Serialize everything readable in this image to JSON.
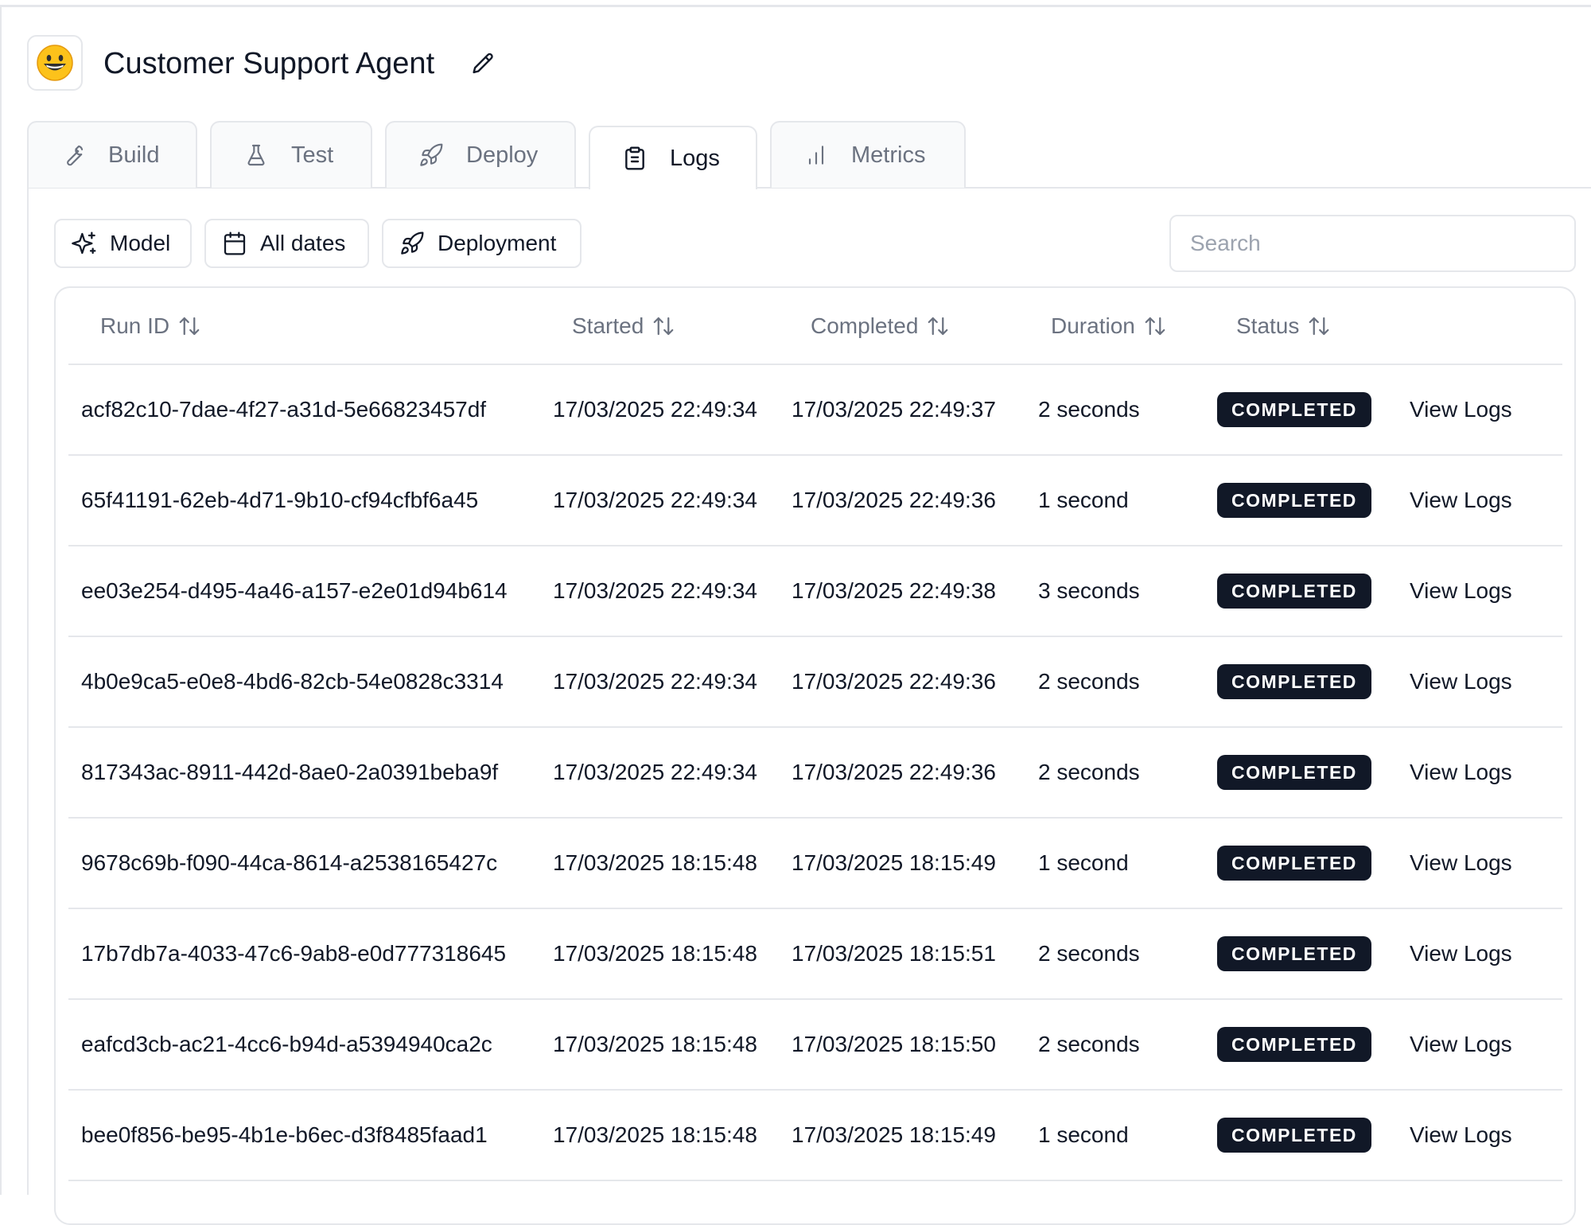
{
  "header": {
    "title": "Customer Support Agent",
    "avatar_emoji": "😀"
  },
  "tabs": [
    {
      "label": "Build",
      "icon": "wrench-icon"
    },
    {
      "label": "Test",
      "icon": "flask-icon"
    },
    {
      "label": "Deploy",
      "icon": "rocket-icon"
    },
    {
      "label": "Logs",
      "icon": "clipboard-icon",
      "active": true
    },
    {
      "label": "Metrics",
      "icon": "bar-chart-icon"
    }
  ],
  "filters": {
    "model": "Model",
    "dates": "All dates",
    "deployment": "Deployment"
  },
  "search": {
    "placeholder": "Search",
    "value": ""
  },
  "table": {
    "columns": [
      "Run ID",
      "Started",
      "Completed",
      "Duration",
      "Status"
    ],
    "rows": [
      {
        "run_id": "acf82c10-7dae-4f27-a31d-5e66823457df",
        "started": "17/03/2025 22:49:34",
        "completed": "17/03/2025 22:49:37",
        "duration": "2 seconds",
        "status": "COMPLETED",
        "action": "View Logs"
      },
      {
        "run_id": "65f41191-62eb-4d71-9b10-cf94cfbf6a45",
        "started": "17/03/2025 22:49:34",
        "completed": "17/03/2025 22:49:36",
        "duration": "1 second",
        "status": "COMPLETED",
        "action": "View Logs"
      },
      {
        "run_id": "ee03e254-d495-4a46-a157-e2e01d94b614",
        "started": "17/03/2025 22:49:34",
        "completed": "17/03/2025 22:49:38",
        "duration": "3 seconds",
        "status": "COMPLETED",
        "action": "View Logs"
      },
      {
        "run_id": "4b0e9ca5-e0e8-4bd6-82cb-54e0828c3314",
        "started": "17/03/2025 22:49:34",
        "completed": "17/03/2025 22:49:36",
        "duration": "2 seconds",
        "status": "COMPLETED",
        "action": "View Logs"
      },
      {
        "run_id": "817343ac-8911-442d-8ae0-2a0391beba9f",
        "started": "17/03/2025 22:49:34",
        "completed": "17/03/2025 22:49:36",
        "duration": "2 seconds",
        "status": "COMPLETED",
        "action": "View Logs"
      },
      {
        "run_id": "9678c69b-f090-44ca-8614-a2538165427c",
        "started": "17/03/2025 18:15:48",
        "completed": "17/03/2025 18:15:49",
        "duration": "1 second",
        "status": "COMPLETED",
        "action": "View Logs"
      },
      {
        "run_id": "17b7db7a-4033-47c6-9ab8-e0d777318645",
        "started": "17/03/2025 18:15:48",
        "completed": "17/03/2025 18:15:51",
        "duration": "2 seconds",
        "status": "COMPLETED",
        "action": "View Logs"
      },
      {
        "run_id": "eafcd3cb-ac21-4cc6-b94d-a5394940ca2c",
        "started": "17/03/2025 18:15:48",
        "completed": "17/03/2025 18:15:50",
        "duration": "2 seconds",
        "status": "COMPLETED",
        "action": "View Logs"
      },
      {
        "run_id": "bee0f856-be95-4b1e-b6ec-d3f8485faad1",
        "started": "17/03/2025 18:15:48",
        "completed": "17/03/2025 18:15:49",
        "duration": "1 second",
        "status": "COMPLETED",
        "action": "View Logs"
      }
    ]
  }
}
